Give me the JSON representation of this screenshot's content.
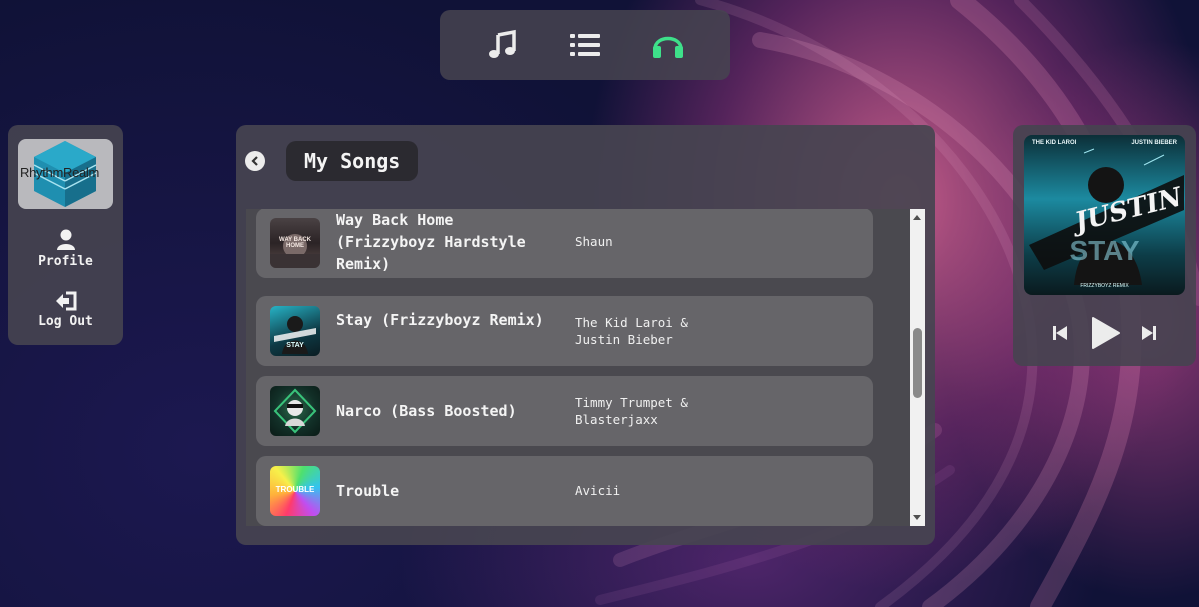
{
  "brand": {
    "logo_text": "RhythmRealm"
  },
  "nav": {
    "items": [
      {
        "icon": "music-note-icon",
        "color": "#ececec"
      },
      {
        "icon": "list-icon",
        "color": "#ececec"
      },
      {
        "icon": "headphones-icon",
        "color": "#3ee08a"
      }
    ]
  },
  "sidebar": {
    "profile_label": "Profile",
    "logout_label": "Log Out"
  },
  "main": {
    "title": "My Songs",
    "songs": [
      {
        "title": "Way Back Home (Frizzyboyz Hardstyle Remix)",
        "artist": "Shaun",
        "art_text": "WAY BACK HOME"
      },
      {
        "title": "Stay (Frizzyboyz Remix)",
        "artist": "The Kid Laroi & Justin Bieber",
        "art_text": "STAY"
      },
      {
        "title": "Narco (Bass Boosted)",
        "artist": "Timmy Trumpet & Blasterjaxx",
        "art_text": ""
      },
      {
        "title": "Trouble",
        "artist": "Avicii",
        "art_text": "TROUBLE"
      }
    ]
  },
  "player": {
    "cover": {
      "top_left": "THE KID LAROI",
      "top_right": "JUSTIN BIEBER",
      "big_text": "STAY",
      "scribble": "JUSTIN",
      "bottom": "FRIZZYBOYZ REMIX"
    },
    "controls": [
      "previous-icon",
      "play-icon",
      "next-icon"
    ]
  },
  "colors": {
    "accent": "#3ee08a",
    "panel": "#46444f",
    "song_row": "#666569"
  }
}
